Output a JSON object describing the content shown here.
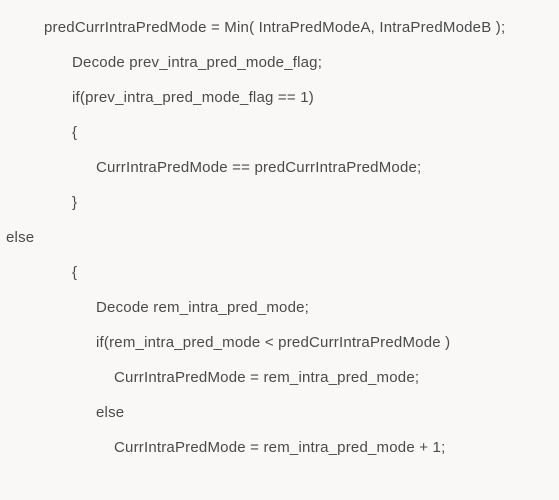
{
  "code": {
    "l1": "predCurrIntraPredMode = Min( IntraPredModeA, IntraPredModeB );",
    "l2": "Decode prev_intra_pred_mode_flag;",
    "l3": "if(prev_intra_pred_mode_flag == 1)",
    "l4": "{",
    "l5": "CurrIntraPredMode == predCurrIntraPredMode;",
    "l6": "}",
    "l7": "else",
    "l8": "{",
    "l9": "Decode rem_intra_pred_mode;",
    "l10": "if(rem_intra_pred_mode < predCurrIntraPredMode )",
    "l11": "CurrIntraPredMode = rem_intra_pred_mode;",
    "l12": "else",
    "l13": "CurrIntraPredMode = rem_intra_pred_mode + 1;"
  }
}
